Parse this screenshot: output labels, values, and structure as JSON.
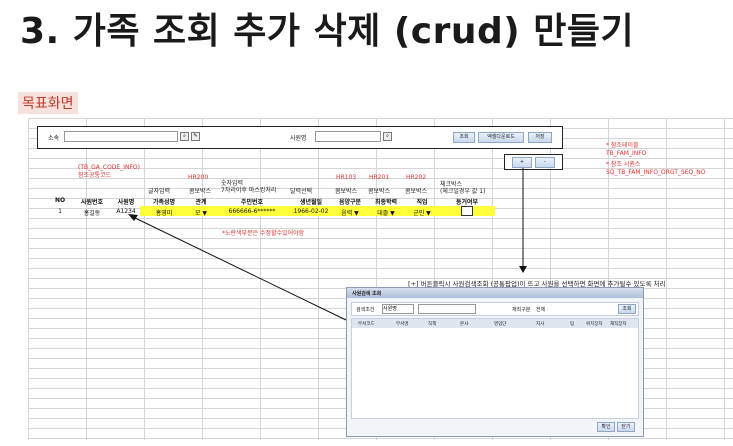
{
  "page": {
    "title": "3. 가족 조회 추가 삭제 (crud) 만들기",
    "badge": "목표화면"
  },
  "search_bar": {
    "label_affiliation": "소속",
    "label_employee": "사원명",
    "buttons": [
      "조회",
      "엑셀다운로드",
      "저장"
    ]
  },
  "notes": {
    "table_name": "* 참조테이블\nTB_FAM_INFO",
    "sequence": "* 참조 시퀀스\nSQ_TB_FAM_INFO_ORGT_SEQ_NO",
    "code_table": "(TB_GA_CODE_INFO)\n참조공통코드",
    "codes": [
      "HR200",
      "HR103",
      "HR201",
      "HR202"
    ],
    "editable": "*노란색부분은 수정할수있어야함",
    "popup_desc": "[+] 버튼클릭시 사원검색조회 (공통팝업)이 뜨고 사원을 선택하면 화면에 추가될수 있도록 처리"
  },
  "nav_buttons": [
    "+",
    "-"
  ],
  "column_types": [
    "글자입력",
    "콤보박스",
    "숫자입력\n7자리이후 마스킹처리",
    "달력선택",
    "콤보박스",
    "콤보박스",
    "콤보박스",
    "체크박스\n(체크일경우 값 1)"
  ],
  "table": {
    "headers": [
      "NO",
      "사원번호",
      "사원명",
      "가족성명",
      "관계",
      "주민번호",
      "생년월일",
      "음양구분",
      "최종학력",
      "직업",
      "동거여부"
    ],
    "rows": [
      [
        "1",
        "홍길동",
        "A1234",
        "홍영미",
        "모",
        "666666-6******",
        "1966-02-02",
        "음력",
        "대졸",
        "군인",
        ""
      ]
    ]
  },
  "popup": {
    "title": "사원검색 조회",
    "search_label": "검색조건",
    "search_value": "사원명",
    "dept_label": "재직구분",
    "dept_value": "전체",
    "search_button": "조회",
    "columns": [
      "부서코드",
      "부서명",
      "직책",
      "본사",
      "영업단",
      "지사",
      "팀",
      "위치장자",
      "재직장자"
    ],
    "buttons": [
      "확인",
      "닫기"
    ]
  }
}
